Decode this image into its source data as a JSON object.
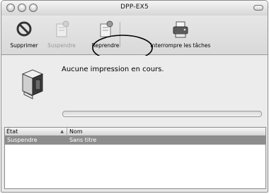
{
  "window": {
    "title": "DPP-EX5"
  },
  "toolbar": {
    "supprimer_label": "Supprimer",
    "suspendre_label": "Suspendre",
    "reprendre_label": "Reprendre",
    "interrompre_label": "Interrompre les tâches"
  },
  "status": {
    "message": "Aucune impression en cours."
  },
  "table": {
    "columns": [
      "État",
      "Nom"
    ],
    "rows": [
      {
        "etat": "Suspendre",
        "nom": "Sans titre",
        "selected": true
      }
    ]
  },
  "colors": {
    "selection": "#8d8d8d",
    "window_bg": "#e8e8e8",
    "annotation": "#000000"
  },
  "icons": [
    "delete-icon",
    "hold-job-icon",
    "resume-job-icon",
    "stop-jobs-icon",
    "printer-icon"
  ]
}
